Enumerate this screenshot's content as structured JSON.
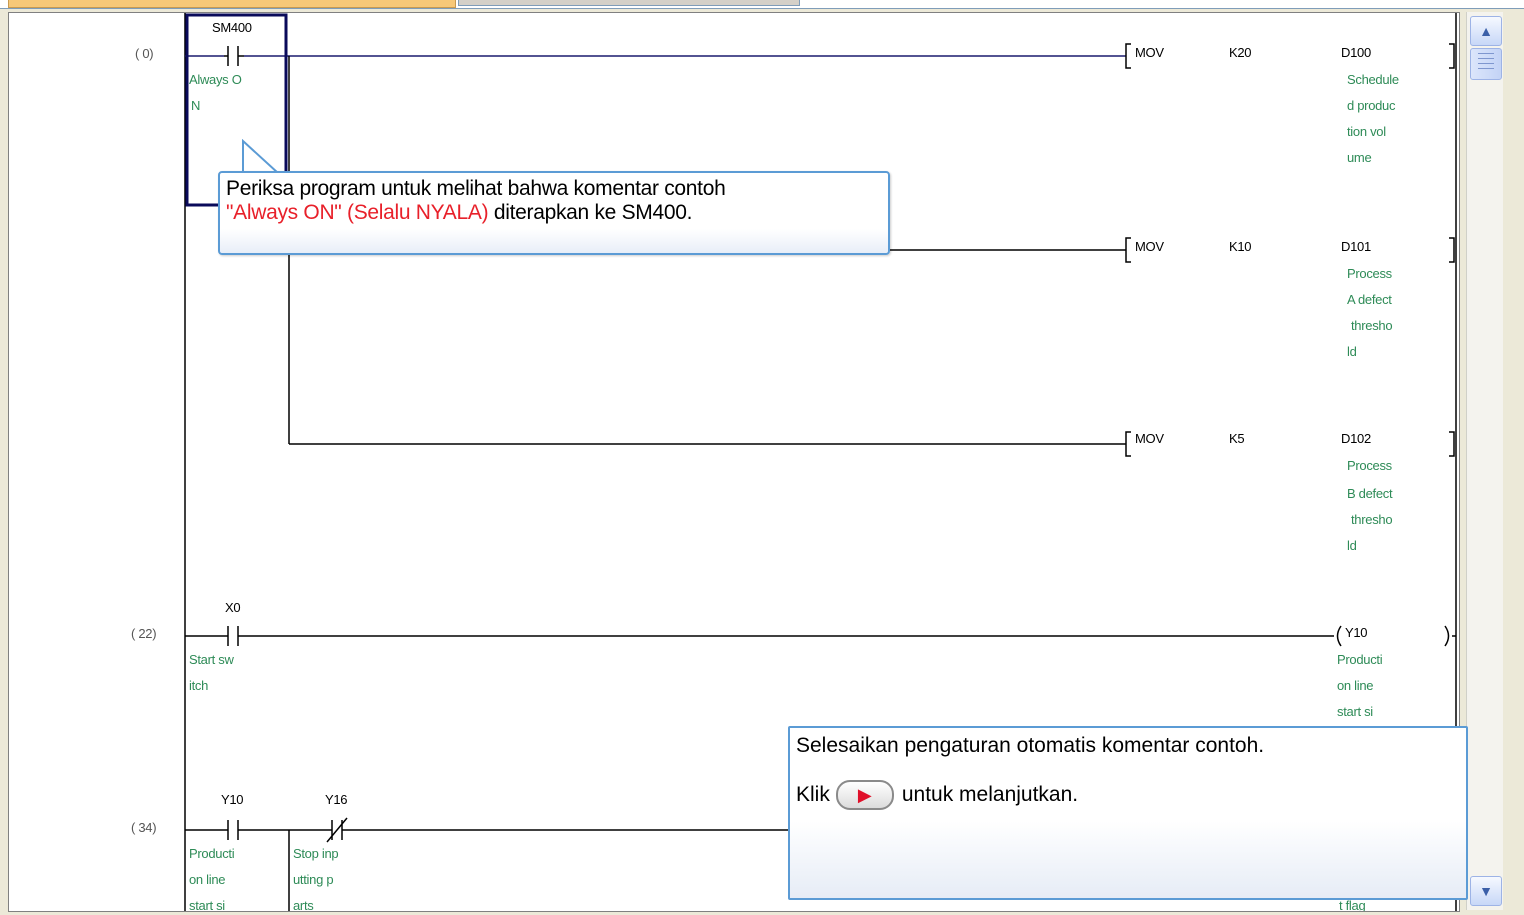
{
  "steps": {
    "s0": "(     0)",
    "s22": "(    22)",
    "s34": "(    34)"
  },
  "devices": {
    "sm400": "SM400",
    "x0": "X0",
    "y10a": "Y10",
    "y16": "Y16"
  },
  "comments": {
    "always_on": [
      "Always O",
      "N"
    ],
    "start_switch": [
      "Start sw",
      "itch"
    ],
    "prod_line_start": [
      "Producti",
      "on line",
      "start si"
    ],
    "stop_inputting": [
      "Stop inp",
      "utting p",
      "arts"
    ],
    "d100": [
      "Schedule",
      "d produc",
      "tion vol",
      "ume"
    ],
    "d101": [
      "Process",
      "A defect",
      "thresho",
      "ld"
    ],
    "d102": [
      "Process",
      "B defect",
      "thresho",
      "ld"
    ],
    "y10_out": [
      "Producti",
      "on line",
      "start si"
    ],
    "bottom_right": "t flag"
  },
  "instructions": [
    {
      "op": "MOV",
      "src": "K20",
      "dst": "D100"
    },
    {
      "op": "MOV",
      "src": "K10",
      "dst": "D101"
    },
    {
      "op": "MOV",
      "src": "K5",
      "dst": "D102"
    }
  ],
  "coil": {
    "label": "Y10"
  },
  "callout_top": {
    "line1": "Periksa program untuk melihat bahwa komentar contoh",
    "line2_red": "\"Always ON\" (Selalu NYALA)",
    "line2_rest": " diterapkan ke SM400."
  },
  "callout_bottom": {
    "message": "Selesaikan pengaturan otomatis komentar contoh.",
    "click_prefix": "Klik",
    "click_suffix": "untuk melanjutkan.",
    "next_icon": "play-arrow-icon"
  },
  "scrollbar": {
    "up_icon": "chevron-up-icon",
    "down_icon": "chevron-down-icon"
  }
}
